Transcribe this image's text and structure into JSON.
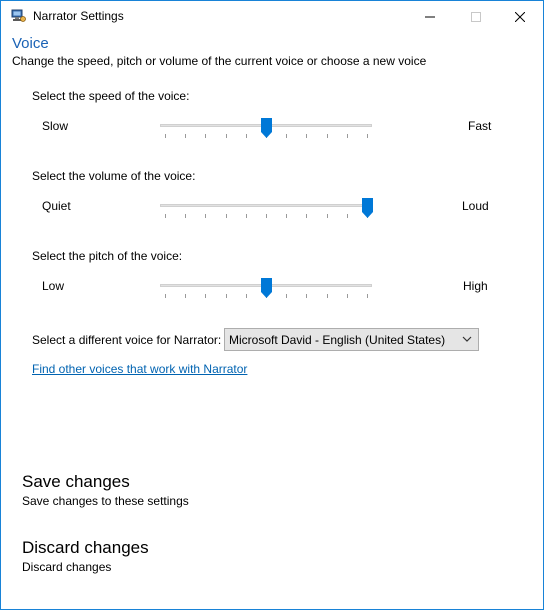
{
  "window": {
    "title": "Narrator Settings",
    "icon": "narrator-app-icon",
    "controls": [
      "minimize",
      "maximize",
      "close"
    ]
  },
  "voice": {
    "heading": "Voice",
    "subheading": "Change the speed, pitch or volume of the current voice or choose a new voice"
  },
  "speed": {
    "label": "Select the speed of the voice:",
    "min_label": "Slow",
    "max_label": "Fast",
    "value_fraction": 0.5
  },
  "volume": {
    "label": "Select the volume of the voice:",
    "min_label": "Quiet",
    "max_label": "Loud",
    "value_fraction": 1.0
  },
  "pitch": {
    "label": "Select the pitch of the voice:",
    "min_label": "Low",
    "max_label": "High",
    "value_fraction": 0.5
  },
  "voice_select": {
    "label": "Select a different voice for Narrator:",
    "selected": "Microsoft David - English (United States)"
  },
  "find_voices_link": "Find other voices that work with Narrator",
  "save": {
    "title": "Save changes",
    "description": "Save changes to these settings"
  },
  "discard": {
    "title": "Discard changes",
    "description": "Discard changes"
  },
  "colors": {
    "accent": "#0078d7",
    "heading": "#1a62b5",
    "link": "#0063b1",
    "border": "#1883d7"
  }
}
